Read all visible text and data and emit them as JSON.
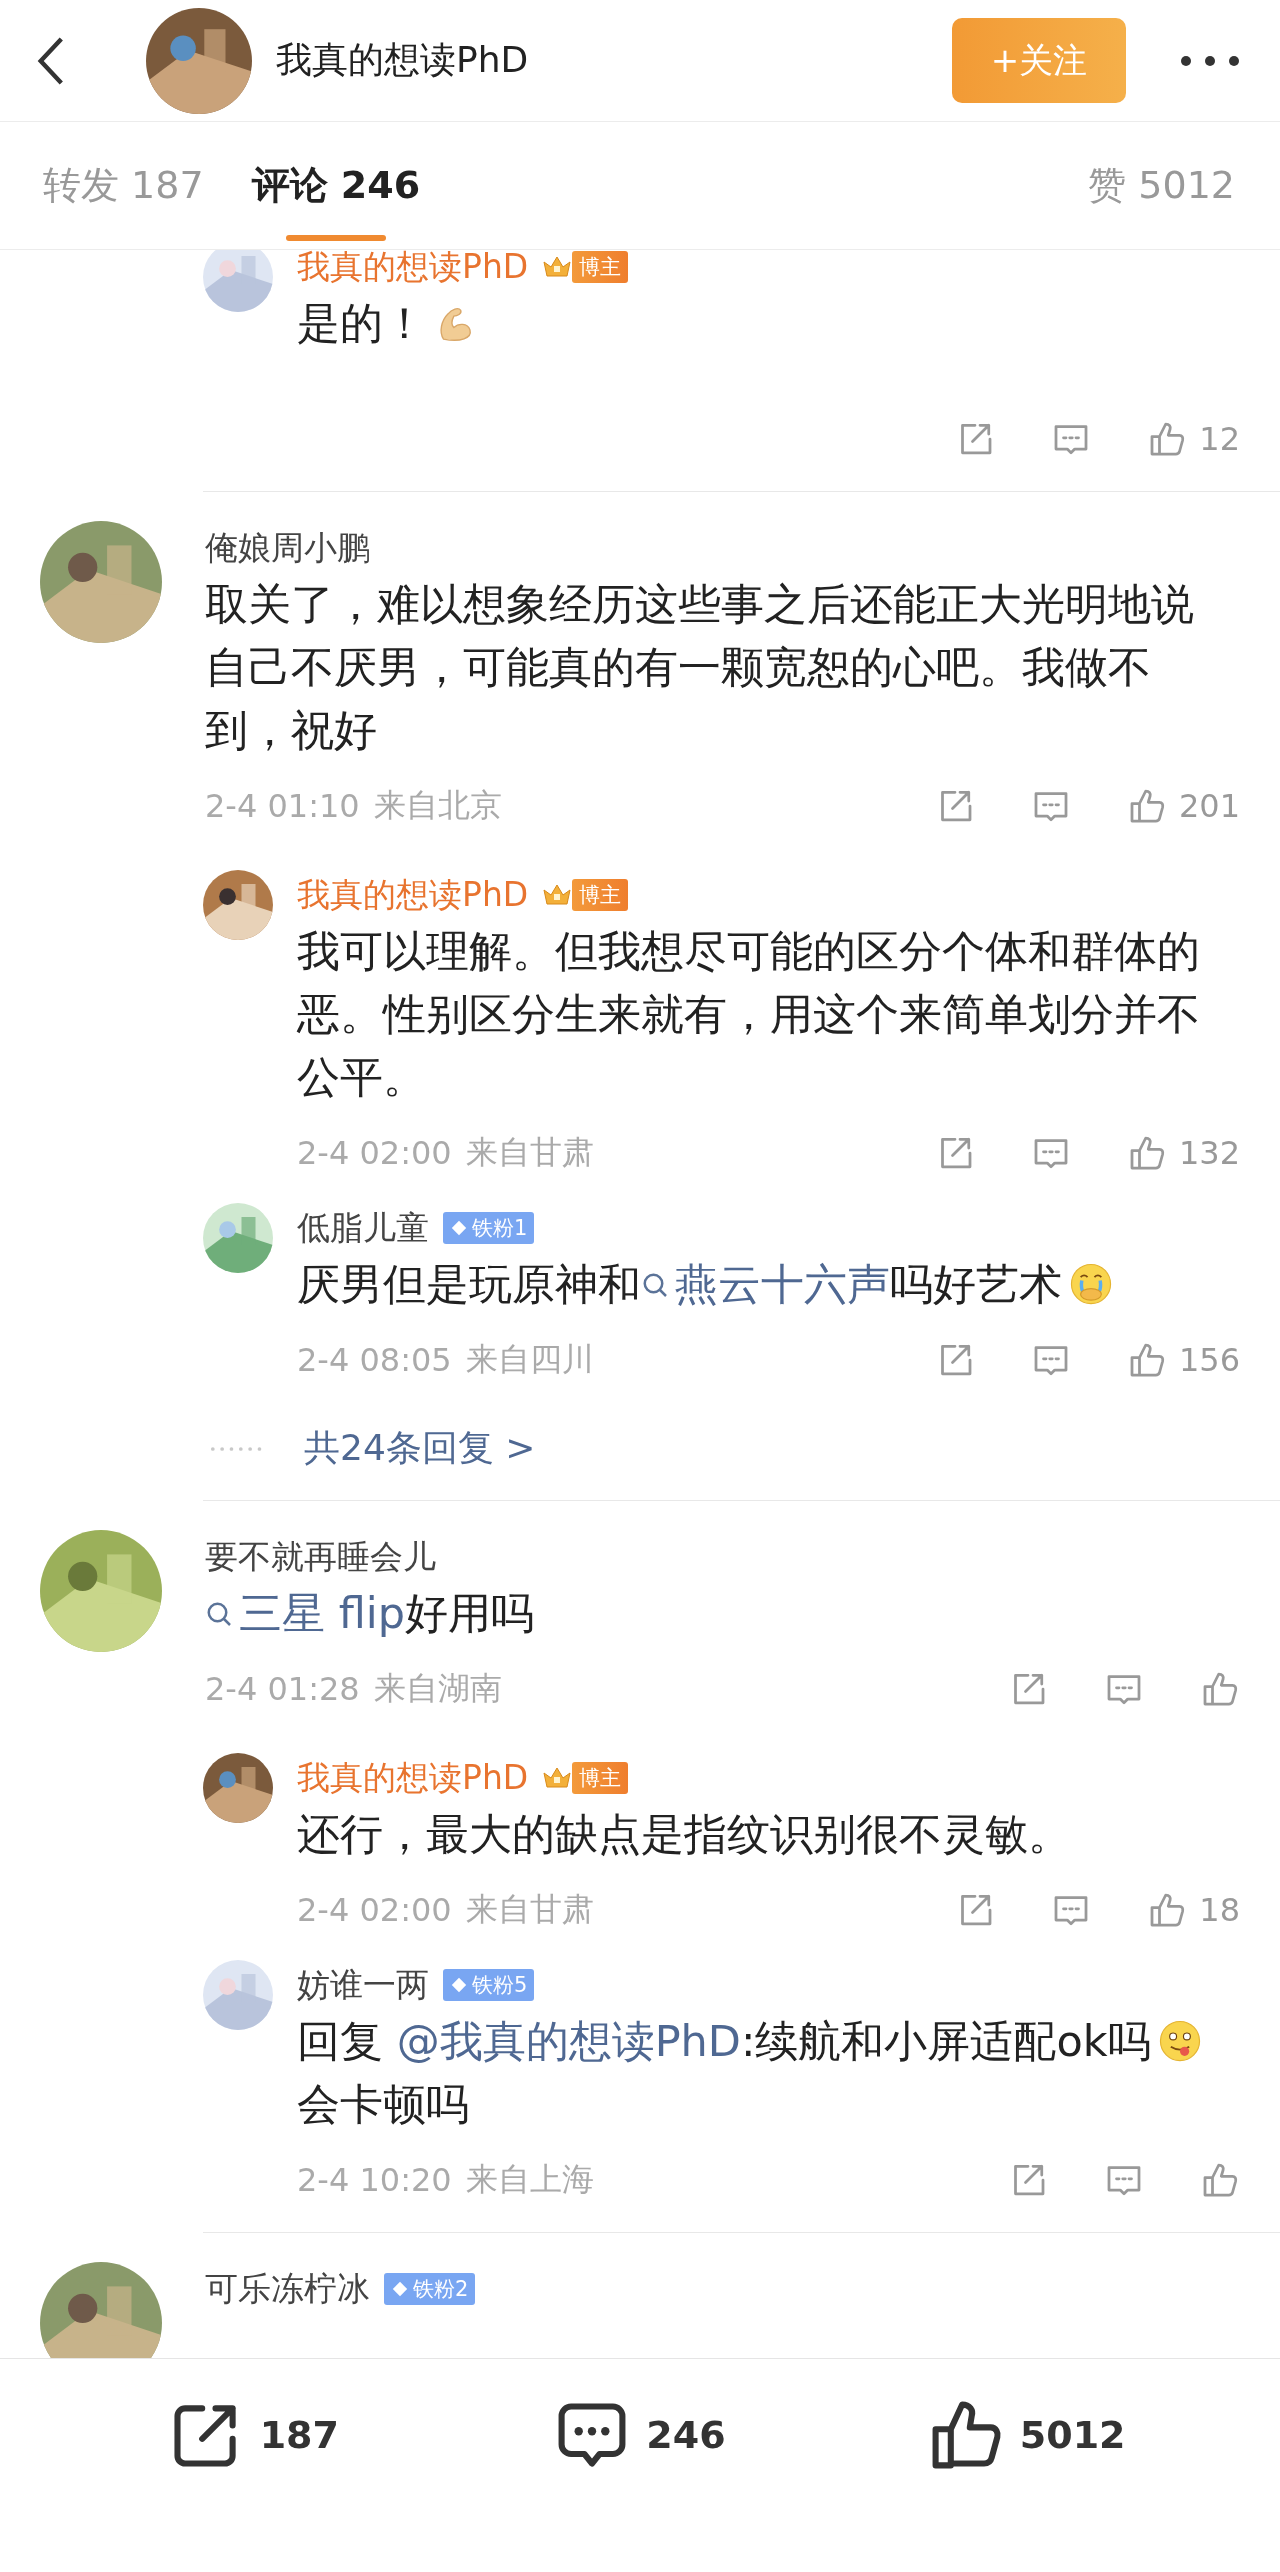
{
  "header": {
    "title": "我真的想读PhD",
    "follow_button": "+关注"
  },
  "tabs": [
    {
      "label": "转发 187",
      "selected": false
    },
    {
      "label": "评论 246",
      "selected": true
    },
    {
      "label": "赞 5012",
      "selected": false
    }
  ],
  "threads": [
    {
      "replies": [
        {
          "author": "我真的想读PhD",
          "badge": {
            "kind": "blogger",
            "label": "博主"
          },
          "text": [
            {
              "kind": "text",
              "text": "是的！"
            },
            {
              "kind": "muscle"
            }
          ],
          "likes": "12"
        }
      ]
    },
    {
      "comment": {
        "author": "俺娘周小鹏",
        "text": [
          {
            "kind": "text",
            "text": "取关了，难以想象经历这些事之后还能正大光明地说自己不厌男，可能真的有一颗宽恕的心吧。我做不到，祝好"
          }
        ],
        "time": "2-4 01:10",
        "location": "来自北京",
        "likes": "201"
      },
      "replies": [
        {
          "author": "我真的想读PhD",
          "badge": {
            "kind": "blogger",
            "label": "博主"
          },
          "text": [
            {
              "kind": "text",
              "text": "我可以理解。但我想尽可能的区分个体和群体的恶。性别区分生来就有，用这个来简单划分并不公平。"
            }
          ],
          "time": "2-4 02:00",
          "location": "来自甘肃",
          "likes": "132"
        },
        {
          "author": "低脂儿童",
          "badge": {
            "kind": "fan",
            "label": "铁粉1"
          },
          "text": [
            {
              "kind": "text",
              "text": "厌男但是玩原神和"
            },
            {
              "kind": "search",
              "text": "燕云十六声"
            },
            {
              "kind": "text",
              "text": "吗好艺术"
            },
            {
              "kind": "crying"
            }
          ],
          "time": "2-4 08:05",
          "location": "来自四川",
          "likes": "156"
        }
      ],
      "more_replies": "共24条回复 >"
    },
    {
      "comment": {
        "author": "要不就再睡会儿",
        "text": [
          {
            "kind": "search",
            "text": "三星 flip"
          },
          {
            "kind": "text",
            "text": "好用吗"
          }
        ],
        "time": "2-4 01:28",
        "location": "来自湖南"
      },
      "replies": [
        {
          "author": "我真的想读PhD",
          "badge": {
            "kind": "blogger",
            "label": "博主"
          },
          "text": [
            {
              "kind": "text",
              "text": "还行，最大的缺点是指纹识别很不灵敏。"
            }
          ],
          "time": "2-4 02:00",
          "location": "来自甘肃",
          "likes": "18"
        },
        {
          "author": "妨谁一两",
          "badge": {
            "kind": "fan",
            "label": "铁粉5"
          },
          "text": [
            {
              "kind": "text",
              "text": "回复 "
            },
            {
              "kind": "mention",
              "text": "@我真的想读PhD"
            },
            {
              "kind": "text",
              "text": ":续航和小屏适配ok吗"
            },
            {
              "kind": "tongue"
            },
            {
              "kind": "text",
              "text": "会卡顿吗"
            }
          ],
          "time": "2-4 10:20",
          "location": "来自上海"
        }
      ]
    },
    {
      "comment": {
        "author": "可乐冻柠冰",
        "badge": {
          "kind": "fan",
          "label": "铁粉2"
        }
      }
    }
  ],
  "bottom_bar": [
    {
      "kind": "repost",
      "count": "187"
    },
    {
      "kind": "comment",
      "count": "246"
    },
    {
      "kind": "like",
      "count": "5012"
    }
  ]
}
